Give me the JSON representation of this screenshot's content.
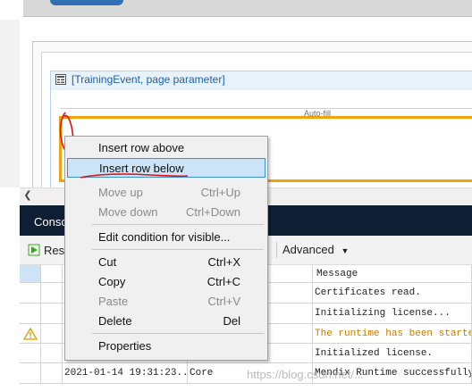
{
  "editor": {
    "dataview_label": "[TrainingEvent, page parameter]",
    "autofill_label": "Auto-fill"
  },
  "context_menu": {
    "items": [
      {
        "label": "Insert row above",
        "shortcut": "",
        "disabled": false
      },
      {
        "label": "Insert row below",
        "shortcut": "",
        "disabled": false,
        "highlighted": true
      },
      {
        "label": "Move up",
        "shortcut": "Ctrl+Up",
        "disabled": true
      },
      {
        "label": "Move down",
        "shortcut": "Ctrl+Down",
        "disabled": true
      },
      {
        "label": "Edit condition for visible...",
        "shortcut": "",
        "disabled": false
      },
      {
        "label": "Cut",
        "shortcut": "Ctrl+X",
        "disabled": false
      },
      {
        "label": "Copy",
        "shortcut": "Ctrl+C",
        "disabled": false
      },
      {
        "label": "Paste",
        "shortcut": "Ctrl+V",
        "disabled": true
      },
      {
        "label": "Delete",
        "shortcut": "Del",
        "disabled": false
      },
      {
        "label": "Properties",
        "shortcut": "",
        "disabled": false
      }
    ]
  },
  "console": {
    "title": "Conso",
    "restart_label": "Rest",
    "advanced_label": "Advanced",
    "columns": [
      "",
      "",
      "",
      "",
      "Message"
    ],
    "rows": [
      {
        "time": "",
        "source": "",
        "message": "Certificates read.",
        "warn": false
      },
      {
        "time": "",
        "source": "",
        "message": "Initializing license...",
        "warn": false
      },
      {
        "time": "",
        "source": "",
        "message": "The runtime has been started w",
        "warn": true
      },
      {
        "time": "",
        "source": "",
        "message": "Initialized license.",
        "warn": false
      },
      {
        "time": "2021-01-14 19:31:23...",
        "source": "Core",
        "message": "Mendix Runtime successfully s",
        "warn": false
      }
    ]
  },
  "watermark": "https://blog.csdn.net/...",
  "icons": {
    "scroll_left": "chevron-left-icon",
    "restart": "restart-icon",
    "warning": "warning-icon",
    "dropdown": "caret-down-icon",
    "dataview": "dataview-icon"
  },
  "colors": {
    "accent_orange": "#f2a10f",
    "console_header": "#0e1e33",
    "menu_highlight": "#cce4f7",
    "annotation_red": "#e01010"
  }
}
